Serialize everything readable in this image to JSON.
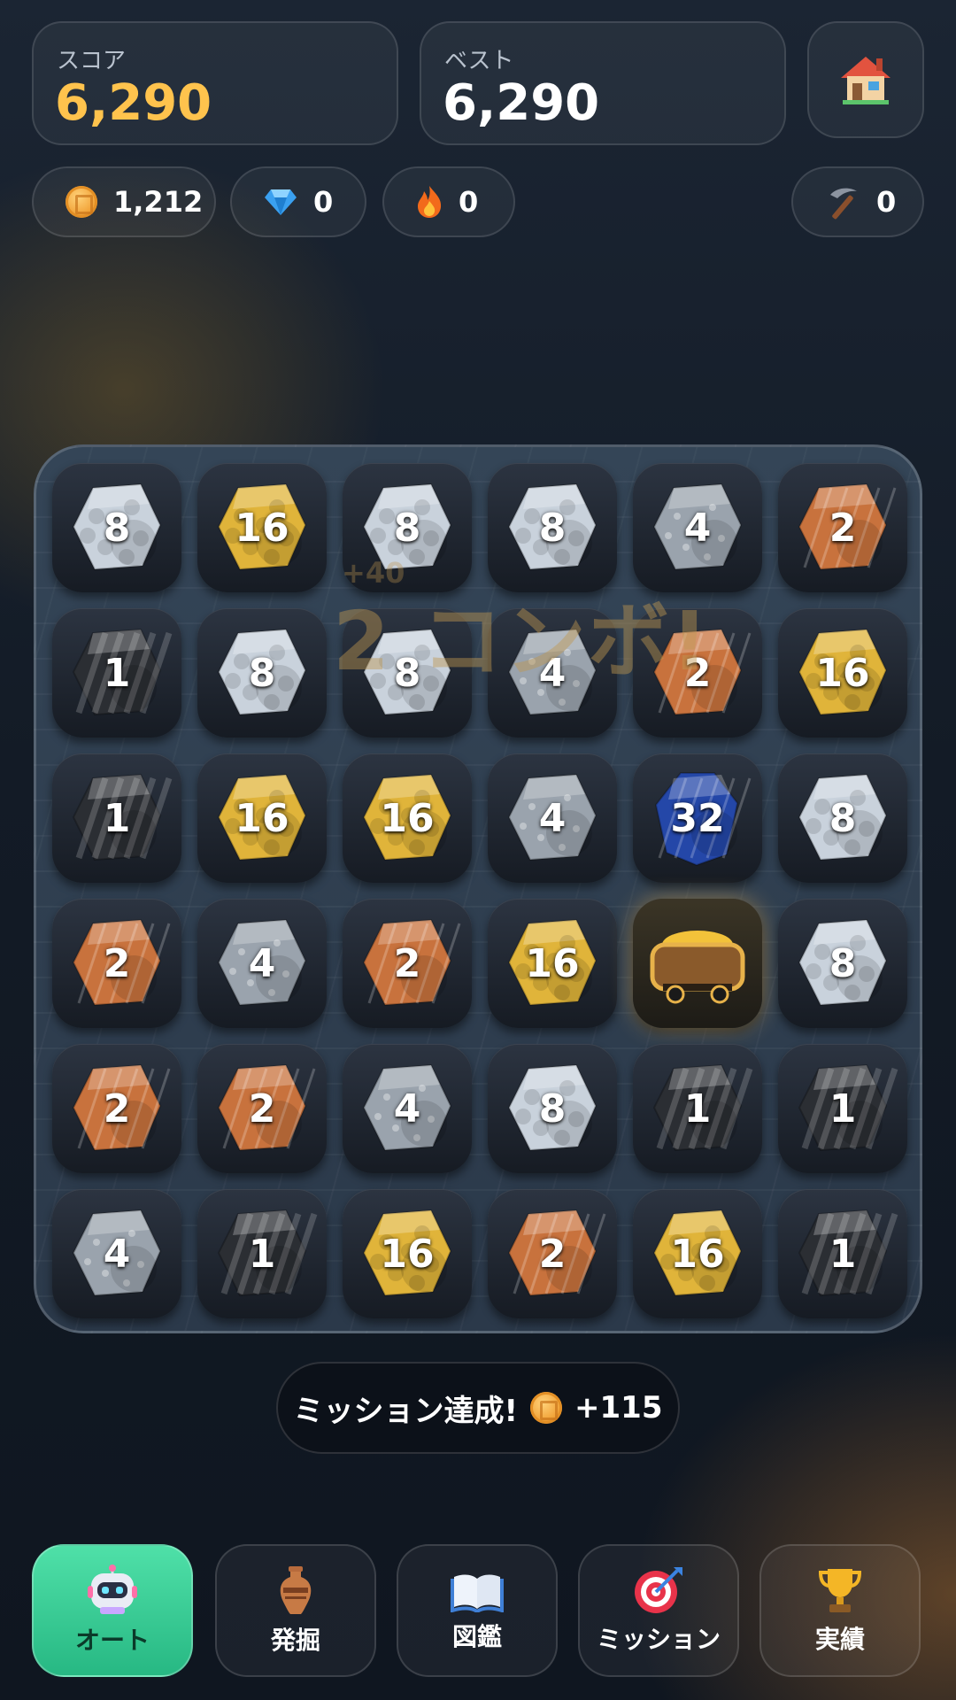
{
  "score": {
    "label": "スコア",
    "value": "6,290"
  },
  "best": {
    "label": "ベスト",
    "value": "6,290"
  },
  "resources": {
    "coins": "1,212",
    "gems": "0",
    "fire": "0",
    "pickaxe": "0"
  },
  "combo": {
    "text": "2 コンボ!",
    "bonus": "+40"
  },
  "board": {
    "rows": 6,
    "cols": 6,
    "tiles": [
      [
        "8",
        "16",
        "8",
        "8",
        "4",
        "2"
      ],
      [
        "1",
        "8",
        "8",
        "4",
        "2",
        "16"
      ],
      [
        "1",
        "16",
        "16",
        "4",
        "32",
        "8"
      ],
      [
        "2",
        "4",
        "2",
        "16",
        "cart",
        "8"
      ],
      [
        "2",
        "2",
        "4",
        "8",
        "1",
        "1"
      ],
      [
        "4",
        "1",
        "16",
        "2",
        "16",
        "1"
      ]
    ],
    "ore_colors": {
      "1": "#2b2e33",
      "2": "#c8723d",
      "4": "#9aa3ad",
      "8": "#c9d2dc",
      "16": "#e0b43a",
      "32": "#2447a8"
    }
  },
  "mission_toast": {
    "text": "ミッション達成!",
    "reward": "+115"
  },
  "nav": {
    "items": [
      {
        "label": "オート",
        "icon": "robot-icon"
      },
      {
        "label": "発掘",
        "icon": "vase-icon"
      },
      {
        "label": "図鑑",
        "icon": "book-icon"
      },
      {
        "label": "ミッション",
        "icon": "target-icon"
      },
      {
        "label": "実績",
        "icon": "trophy-icon"
      }
    ]
  }
}
